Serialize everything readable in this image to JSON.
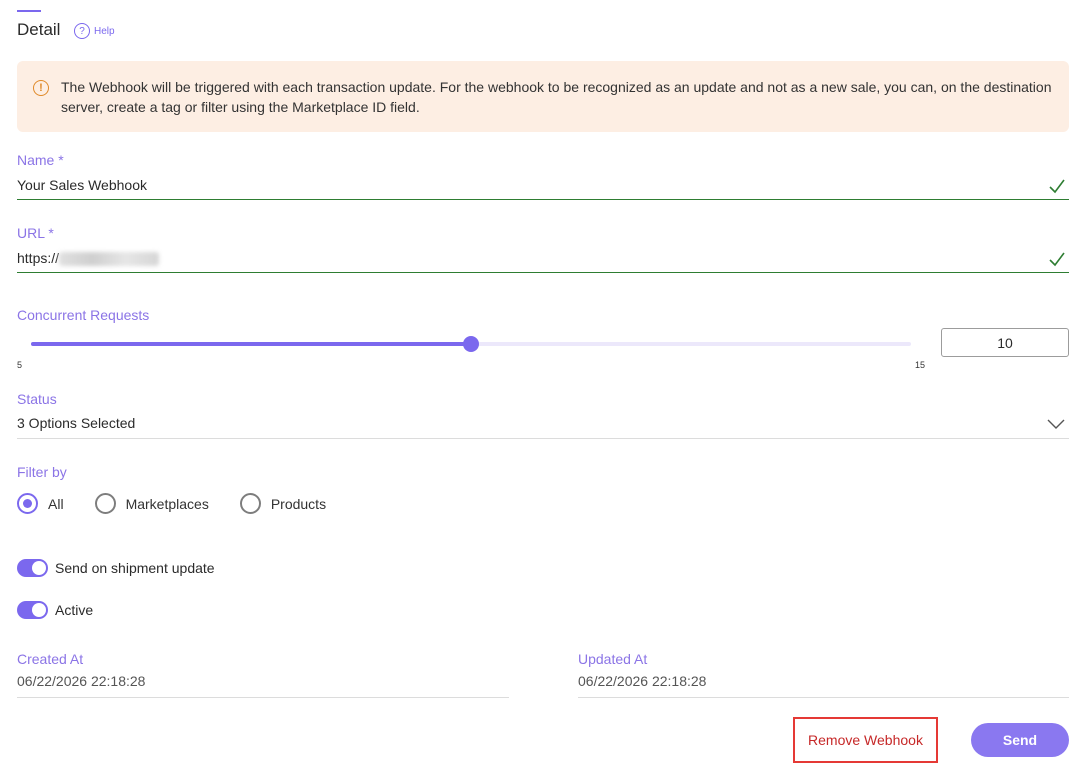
{
  "header": {
    "title": "Detail",
    "help_label": "Help",
    "help_icon": "?"
  },
  "alert": {
    "icon": "!",
    "text": "The Webhook will be triggered with each transaction update. For the webhook to be recognized as an update and not as a new sale, you can, on the destination server, create a tag or filter using the Marketplace ID field."
  },
  "form": {
    "name": {
      "label": "Name *",
      "value": "Your Sales Webhook"
    },
    "url": {
      "label": "URL *",
      "value_prefix": "https://"
    },
    "concurrent": {
      "label": "Concurrent Requests",
      "min": "5",
      "max": "15",
      "value": "10",
      "level": 10
    },
    "status": {
      "label": "Status",
      "value": "3 Options Selected"
    },
    "filter": {
      "label": "Filter by",
      "options": [
        "All",
        "Marketplaces",
        "Products"
      ],
      "selected": "All"
    },
    "toggles": {
      "shipment": "Send on shipment update",
      "active": "Active"
    }
  },
  "meta": {
    "created_label": "Created At",
    "created_value": "06/22/2026 22:18:28",
    "updated_label": "Updated At",
    "updated_value": "06/22/2026 22:18:28"
  },
  "actions": {
    "remove": "Remove Webhook",
    "send": "Send"
  },
  "colors": {
    "accent": "#7b68ee",
    "alert_bg": "#fdeee3",
    "valid": "#2e7d32",
    "danger": "#e53935"
  }
}
